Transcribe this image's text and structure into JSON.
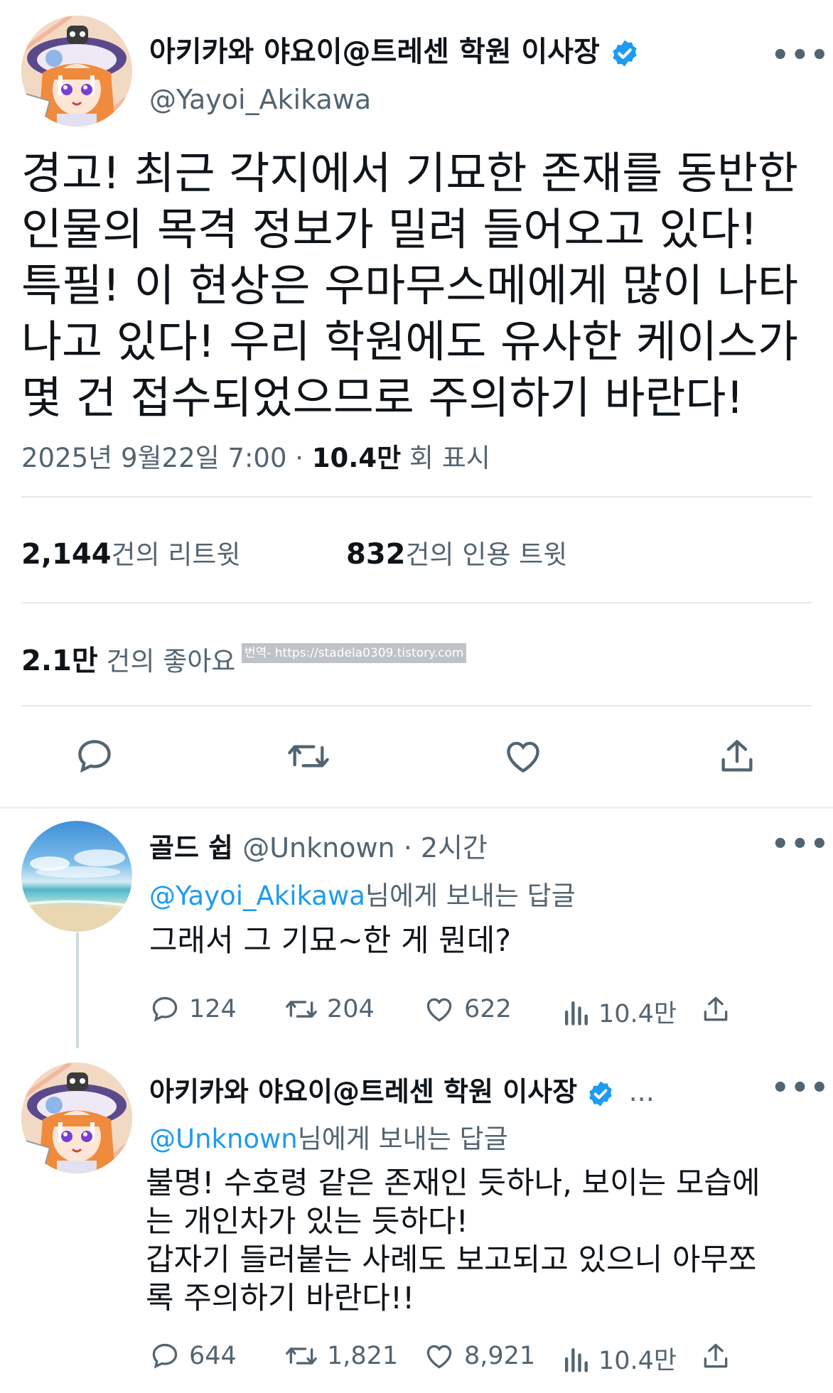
{
  "main_tweet": {
    "display_name": "아키카와 야요이@트레센 학원 이사장",
    "handle": "@Yayoi_Akikawa",
    "more": "•••",
    "text_lines": [
      "경고! 최근 각지에서 기묘한 존재를 동반한",
      "인물의 목격 정보가 밀려 들어오고 있다!",
      "특필! 이 현상은 우마무스메에게 많이 나타",
      "나고 있다! 우리 학원에도 유사한 케이스가",
      "몇 건 접수되었으므로 주의하기 바란다!"
    ],
    "meta_time": "2025년 9월22일  7:00 · ",
    "views": "10.4만",
    "views_suffix": " 회 표시",
    "retweets_count": "2,144",
    "retweets_label": "건의 리트윗",
    "quotes_count": "832",
    "quotes_label": "건의 인용 트윗",
    "likes_count": "2.1만",
    "likes_label": " 건의 좋아요",
    "watermark": "번역- https://stadela0309.tistory.com"
  },
  "reply1": {
    "display_name": "골드 쉽",
    "handle": "@Unknown · 2시간",
    "more": "•••",
    "replying_mention": "@Yayoi_Akikawa",
    "replying_suffix": "님에게 보내는 답글",
    "text": "그래서 그 기묘~한 게 뭔데?",
    "replies": "124",
    "retweets": "204",
    "likes": "622",
    "views": "10.4만"
  },
  "reply2": {
    "display_name": "아키카와 야요이@트레센 학원 이사장",
    "ellipsis": "...",
    "more": "•••",
    "replying_mention": "@Unknown",
    "replying_suffix": "님에게 보내는 답글",
    "text_lines": [
      "불명! 수호령 같은 존재인 듯하나, 보이는 모습에",
      "는 개인차가 있는 듯하다!",
      "갑자기 들러붙는 사례도 보고되고 있으니 아무쪼",
      "록 주의하기 바란다!!"
    ],
    "replies": "644",
    "retweets": "1,821",
    "likes": "8,921",
    "views": "10.4만"
  },
  "colors": {
    "accent": "#1d9bf0",
    "secondary_text": "#536471",
    "divider": "#e5e8eb"
  },
  "icons": [
    "verified-badge-icon",
    "more-icon",
    "reply-icon",
    "retweet-icon",
    "like-icon",
    "share-icon",
    "views-icon"
  ]
}
